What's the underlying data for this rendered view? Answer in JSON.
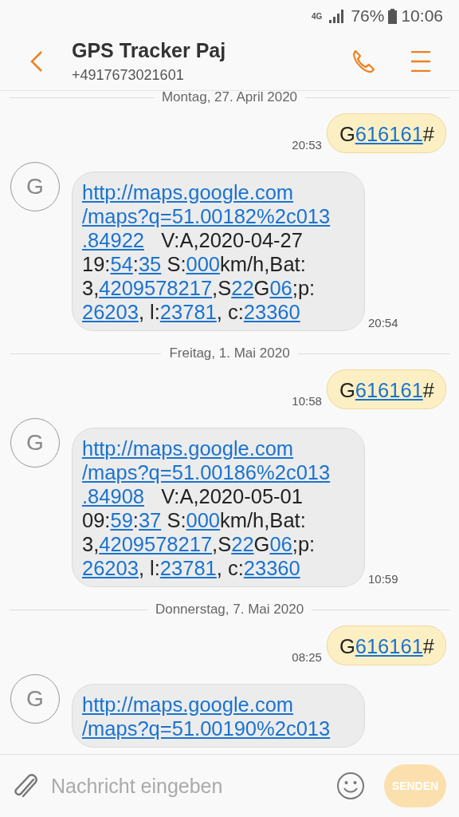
{
  "status_bar": {
    "network": "4G",
    "battery": "76%",
    "time": "10:06"
  },
  "header": {
    "title": "GPS Tracker Paj",
    "subtitle": "+4917673021601"
  },
  "conversation": [
    {
      "kind": "date",
      "text": "Montag, 27. April 2020"
    },
    {
      "kind": "sent",
      "time": "20:53",
      "lines": [
        [
          {
            "t": "G",
            "link": false
          },
          {
            "t": "616161",
            "link": true
          },
          {
            "t": "#",
            "link": false
          }
        ]
      ]
    },
    {
      "kind": "received",
      "avatar": "G",
      "time": "20:54",
      "lines": [
        [
          {
            "t": "http://maps.google.com",
            "link": true
          }
        ],
        [
          {
            "t": "/maps?q=51.00182%2c013",
            "link": true
          }
        ],
        [
          {
            "t": ".84922",
            "link": true
          },
          {
            "t": "   V:A,2020-04-27",
            "link": false
          }
        ],
        [
          {
            "t": "19:",
            "link": false
          },
          {
            "t": "54",
            "link": true
          },
          {
            "t": ":",
            "link": false
          },
          {
            "t": "35",
            "link": true
          },
          {
            "t": " S:",
            "link": false
          },
          {
            "t": "000",
            "link": true
          },
          {
            "t": "km/h,Bat:",
            "link": false
          }
        ],
        [
          {
            "t": "3,",
            "link": false
          },
          {
            "t": "4209578217",
            "link": true
          },
          {
            "t": ",S",
            "link": false
          },
          {
            "t": "22",
            "link": true
          },
          {
            "t": "G",
            "link": false
          },
          {
            "t": "06",
            "link": true
          },
          {
            "t": ";p:",
            "link": false
          }
        ],
        [
          {
            "t": "26203",
            "link": true
          },
          {
            "t": ", l:",
            "link": false
          },
          {
            "t": "23781",
            "link": true
          },
          {
            "t": ", c:",
            "link": false
          },
          {
            "t": "23360",
            "link": true
          }
        ]
      ]
    },
    {
      "kind": "date",
      "text": "Freitag, 1. Mai 2020"
    },
    {
      "kind": "sent",
      "time": "10:58",
      "lines": [
        [
          {
            "t": "G",
            "link": false
          },
          {
            "t": "616161",
            "link": true
          },
          {
            "t": "#",
            "link": false
          }
        ]
      ]
    },
    {
      "kind": "received",
      "avatar": "G",
      "time": "10:59",
      "lines": [
        [
          {
            "t": "http://maps.google.com",
            "link": true
          }
        ],
        [
          {
            "t": "/maps?q=51.00186%2c013",
            "link": true
          }
        ],
        [
          {
            "t": ".84908",
            "link": true
          },
          {
            "t": "   V:A,2020-05-01",
            "link": false
          }
        ],
        [
          {
            "t": "09:",
            "link": false
          },
          {
            "t": "59",
            "link": true
          },
          {
            "t": ":",
            "link": false
          },
          {
            "t": "37",
            "link": true
          },
          {
            "t": " S:",
            "link": false
          },
          {
            "t": "000",
            "link": true
          },
          {
            "t": "km/h,Bat:",
            "link": false
          }
        ],
        [
          {
            "t": "3,",
            "link": false
          },
          {
            "t": "4209578217",
            "link": true
          },
          {
            "t": ",S",
            "link": false
          },
          {
            "t": "22",
            "link": true
          },
          {
            "t": "G",
            "link": false
          },
          {
            "t": "06",
            "link": true
          },
          {
            "t": ";p:",
            "link": false
          }
        ],
        [
          {
            "t": "26203",
            "link": true
          },
          {
            "t": ", l:",
            "link": false
          },
          {
            "t": "23781",
            "link": true
          },
          {
            "t": ", c:",
            "link": false
          },
          {
            "t": "23360",
            "link": true
          }
        ]
      ]
    },
    {
      "kind": "date",
      "text": "Donnerstag, 7. Mai 2020"
    },
    {
      "kind": "sent",
      "time": "08:25",
      "lines": [
        [
          {
            "t": "G",
            "link": false
          },
          {
            "t": "616161",
            "link": true
          },
          {
            "t": "#",
            "link": false
          }
        ]
      ]
    },
    {
      "kind": "received",
      "avatar": "G",
      "lines": [
        [
          {
            "t": "http://maps.google.com",
            "link": true
          }
        ],
        [
          {
            "t": "/maps?q=51.00190%2c013",
            "link": true
          }
        ]
      ]
    }
  ],
  "composer": {
    "placeholder": "Nachricht eingeben",
    "send": "SENDEN",
    "send_disabled": true
  }
}
